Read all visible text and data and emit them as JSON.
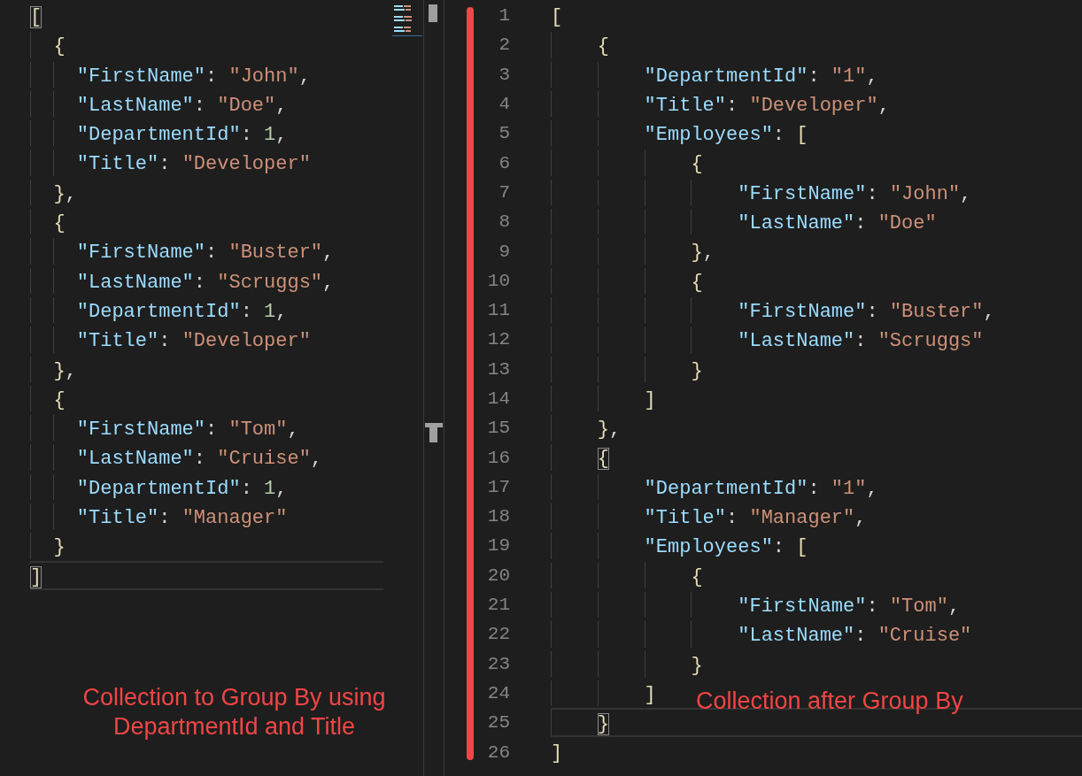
{
  "left_editor": {
    "lines": [
      {
        "current": false,
        "bracket_match": true,
        "tokens": [
          {
            "kind": "bracket",
            "text": "["
          }
        ],
        "children": [
          {
            "current": false,
            "bracket_match": false,
            "tokens": [
              {
                "kind": "bracket",
                "text": "{"
              }
            ],
            "children": [
              {
                "current": false,
                "bracket_match": false,
                "tokens": [
                  {
                    "kind": "key",
                    "text": "\"FirstName\""
                  },
                  {
                    "kind": "punct",
                    "text": ": "
                  },
                  {
                    "kind": "string",
                    "text": "\"John\""
                  },
                  {
                    "kind": "punct",
                    "text": ","
                  }
                ]
              },
              {
                "current": false,
                "bracket_match": false,
                "tokens": [
                  {
                    "kind": "key",
                    "text": "\"LastName\""
                  },
                  {
                    "kind": "punct",
                    "text": ": "
                  },
                  {
                    "kind": "string",
                    "text": "\"Doe\""
                  },
                  {
                    "kind": "punct",
                    "text": ","
                  }
                ]
              },
              {
                "current": false,
                "bracket_match": false,
                "tokens": [
                  {
                    "kind": "key",
                    "text": "\"DepartmentId\""
                  },
                  {
                    "kind": "punct",
                    "text": ": "
                  },
                  {
                    "kind": "number",
                    "text": "1"
                  },
                  {
                    "kind": "punct",
                    "text": ","
                  }
                ]
              },
              {
                "current": false,
                "bracket_match": false,
                "tokens": [
                  {
                    "kind": "key",
                    "text": "\"Title\""
                  },
                  {
                    "kind": "punct",
                    "text": ": "
                  },
                  {
                    "kind": "string",
                    "text": "\"Developer\""
                  }
                ]
              }
            ]
          },
          {
            "current": false,
            "bracket_match": false,
            "tokens": [
              {
                "kind": "bracket",
                "text": "}"
              },
              {
                "kind": "punct",
                "text": ","
              }
            ]
          },
          {
            "current": false,
            "bracket_match": false,
            "tokens": [
              {
                "kind": "bracket",
                "text": "{"
              }
            ],
            "children": [
              {
                "current": false,
                "bracket_match": false,
                "tokens": [
                  {
                    "kind": "key",
                    "text": "\"FirstName\""
                  },
                  {
                    "kind": "punct",
                    "text": ": "
                  },
                  {
                    "kind": "string",
                    "text": "\"Buster\""
                  },
                  {
                    "kind": "punct",
                    "text": ","
                  }
                ]
              },
              {
                "current": false,
                "bracket_match": false,
                "tokens": [
                  {
                    "kind": "key",
                    "text": "\"LastName\""
                  },
                  {
                    "kind": "punct",
                    "text": ": "
                  },
                  {
                    "kind": "string",
                    "text": "\"Scruggs\""
                  },
                  {
                    "kind": "punct",
                    "text": ","
                  }
                ]
              },
              {
                "current": false,
                "bracket_match": false,
                "tokens": [
                  {
                    "kind": "key",
                    "text": "\"DepartmentId\""
                  },
                  {
                    "kind": "punct",
                    "text": ": "
                  },
                  {
                    "kind": "number",
                    "text": "1"
                  },
                  {
                    "kind": "punct",
                    "text": ","
                  }
                ]
              },
              {
                "current": false,
                "bracket_match": false,
                "tokens": [
                  {
                    "kind": "key",
                    "text": "\"Title\""
                  },
                  {
                    "kind": "punct",
                    "text": ": "
                  },
                  {
                    "kind": "string",
                    "text": "\"Developer\""
                  }
                ]
              }
            ]
          },
          {
            "current": false,
            "bracket_match": false,
            "tokens": [
              {
                "kind": "bracket",
                "text": "}"
              },
              {
                "kind": "punct",
                "text": ","
              }
            ]
          },
          {
            "current": false,
            "bracket_match": false,
            "tokens": [
              {
                "kind": "bracket",
                "text": "{"
              }
            ],
            "children": [
              {
                "current": false,
                "bracket_match": false,
                "tokens": [
                  {
                    "kind": "key",
                    "text": "\"FirstName\""
                  },
                  {
                    "kind": "punct",
                    "text": ": "
                  },
                  {
                    "kind": "string",
                    "text": "\"Tom\""
                  },
                  {
                    "kind": "punct",
                    "text": ","
                  }
                ]
              },
              {
                "current": false,
                "bracket_match": false,
                "tokens": [
                  {
                    "kind": "key",
                    "text": "\"LastName\""
                  },
                  {
                    "kind": "punct",
                    "text": ": "
                  },
                  {
                    "kind": "string",
                    "text": "\"Cruise\""
                  },
                  {
                    "kind": "punct",
                    "text": ","
                  }
                ]
              },
              {
                "current": false,
                "bracket_match": false,
                "tokens": [
                  {
                    "kind": "key",
                    "text": "\"DepartmentId\""
                  },
                  {
                    "kind": "punct",
                    "text": ": "
                  },
                  {
                    "kind": "number",
                    "text": "1"
                  },
                  {
                    "kind": "punct",
                    "text": ","
                  }
                ]
              },
              {
                "current": false,
                "bracket_match": false,
                "tokens": [
                  {
                    "kind": "key",
                    "text": "\"Title\""
                  },
                  {
                    "kind": "punct",
                    "text": ": "
                  },
                  {
                    "kind": "string",
                    "text": "\"Manager\""
                  }
                ]
              }
            ]
          },
          {
            "current": false,
            "bracket_match": false,
            "tokens": [
              {
                "kind": "bracket",
                "text": "}"
              }
            ]
          }
        ]
      },
      {
        "current": true,
        "bracket_match": true,
        "tokens": [
          {
            "kind": "bracket",
            "text": "]"
          }
        ]
      }
    ],
    "caption": "Collection to Group By using DepartmentId and Title"
  },
  "right_editor": {
    "lines": [
      {
        "number": "1",
        "current": false,
        "bracket_match": false,
        "tokens": [
          {
            "kind": "bracket",
            "text": "["
          }
        ],
        "children": [
          {
            "number": "2",
            "current": false,
            "bracket_match": false,
            "tokens": [
              {
                "kind": "bracket",
                "text": "{"
              }
            ],
            "children": [
              {
                "number": "3",
                "current": false,
                "bracket_match": false,
                "tokens": [
                  {
                    "kind": "key",
                    "text": "\"DepartmentId\""
                  },
                  {
                    "kind": "punct",
                    "text": ": "
                  },
                  {
                    "kind": "string",
                    "text": "\"1\""
                  },
                  {
                    "kind": "punct",
                    "text": ","
                  }
                ]
              },
              {
                "number": "4",
                "current": false,
                "bracket_match": false,
                "tokens": [
                  {
                    "kind": "key",
                    "text": "\"Title\""
                  },
                  {
                    "kind": "punct",
                    "text": ": "
                  },
                  {
                    "kind": "string",
                    "text": "\"Developer\""
                  },
                  {
                    "kind": "punct",
                    "text": ","
                  }
                ]
              },
              {
                "number": "5",
                "current": false,
                "bracket_match": false,
                "tokens": [
                  {
                    "kind": "key",
                    "text": "\"Employees\""
                  },
                  {
                    "kind": "punct",
                    "text": ": "
                  },
                  {
                    "kind": "bracket",
                    "text": "["
                  }
                ],
                "children": [
                  {
                    "number": "6",
                    "current": false,
                    "bracket_match": false,
                    "tokens": [
                      {
                        "kind": "bracket",
                        "text": "{"
                      }
                    ],
                    "children": [
                      {
                        "number": "7",
                        "current": false,
                        "bracket_match": false,
                        "tokens": [
                          {
                            "kind": "key",
                            "text": "\"FirstName\""
                          },
                          {
                            "kind": "punct",
                            "text": ": "
                          },
                          {
                            "kind": "string",
                            "text": "\"John\""
                          },
                          {
                            "kind": "punct",
                            "text": ","
                          }
                        ]
                      },
                      {
                        "number": "8",
                        "current": false,
                        "bracket_match": false,
                        "tokens": [
                          {
                            "kind": "key",
                            "text": "\"LastName\""
                          },
                          {
                            "kind": "punct",
                            "text": ": "
                          },
                          {
                            "kind": "string",
                            "text": "\"Doe\""
                          }
                        ]
                      }
                    ]
                  },
                  {
                    "number": "9",
                    "current": false,
                    "bracket_match": false,
                    "tokens": [
                      {
                        "kind": "bracket",
                        "text": "}"
                      },
                      {
                        "kind": "punct",
                        "text": ","
                      }
                    ]
                  },
                  {
                    "number": "10",
                    "current": false,
                    "bracket_match": false,
                    "tokens": [
                      {
                        "kind": "bracket",
                        "text": "{"
                      }
                    ],
                    "children": [
                      {
                        "number": "11",
                        "current": false,
                        "bracket_match": false,
                        "tokens": [
                          {
                            "kind": "key",
                            "text": "\"FirstName\""
                          },
                          {
                            "kind": "punct",
                            "text": ": "
                          },
                          {
                            "kind": "string",
                            "text": "\"Buster\""
                          },
                          {
                            "kind": "punct",
                            "text": ","
                          }
                        ]
                      },
                      {
                        "number": "12",
                        "current": false,
                        "bracket_match": false,
                        "tokens": [
                          {
                            "kind": "key",
                            "text": "\"LastName\""
                          },
                          {
                            "kind": "punct",
                            "text": ": "
                          },
                          {
                            "kind": "string",
                            "text": "\"Scruggs\""
                          }
                        ]
                      }
                    ]
                  },
                  {
                    "number": "13",
                    "current": false,
                    "bracket_match": false,
                    "tokens": [
                      {
                        "kind": "bracket",
                        "text": "}"
                      }
                    ]
                  }
                ]
              },
              {
                "number": "14",
                "current": false,
                "bracket_match": false,
                "tokens": [
                  {
                    "kind": "bracket",
                    "text": "]"
                  }
                ]
              }
            ]
          },
          {
            "number": "15",
            "current": false,
            "bracket_match": false,
            "tokens": [
              {
                "kind": "bracket",
                "text": "}"
              },
              {
                "kind": "punct",
                "text": ","
              }
            ]
          },
          {
            "number": "16",
            "current": false,
            "bracket_match": true,
            "tokens": [
              {
                "kind": "bracket",
                "text": "{"
              }
            ],
            "children": [
              {
                "number": "17",
                "current": false,
                "bracket_match": false,
                "tokens": [
                  {
                    "kind": "key",
                    "text": "\"DepartmentId\""
                  },
                  {
                    "kind": "punct",
                    "text": ": "
                  },
                  {
                    "kind": "string",
                    "text": "\"1\""
                  },
                  {
                    "kind": "punct",
                    "text": ","
                  }
                ]
              },
              {
                "number": "18",
                "current": false,
                "bracket_match": false,
                "tokens": [
                  {
                    "kind": "key",
                    "text": "\"Title\""
                  },
                  {
                    "kind": "punct",
                    "text": ": "
                  },
                  {
                    "kind": "string",
                    "text": "\"Manager\""
                  },
                  {
                    "kind": "punct",
                    "text": ","
                  }
                ]
              },
              {
                "number": "19",
                "current": false,
                "bracket_match": false,
                "tokens": [
                  {
                    "kind": "key",
                    "text": "\"Employees\""
                  },
                  {
                    "kind": "punct",
                    "text": ": "
                  },
                  {
                    "kind": "bracket",
                    "text": "["
                  }
                ],
                "children": [
                  {
                    "number": "20",
                    "current": false,
                    "bracket_match": false,
                    "tokens": [
                      {
                        "kind": "bracket",
                        "text": "{"
                      }
                    ],
                    "children": [
                      {
                        "number": "21",
                        "current": false,
                        "bracket_match": false,
                        "tokens": [
                          {
                            "kind": "key",
                            "text": "\"FirstName\""
                          },
                          {
                            "kind": "punct",
                            "text": ": "
                          },
                          {
                            "kind": "string",
                            "text": "\"Tom\""
                          },
                          {
                            "kind": "punct",
                            "text": ","
                          }
                        ]
                      },
                      {
                        "number": "22",
                        "current": false,
                        "bracket_match": false,
                        "tokens": [
                          {
                            "kind": "key",
                            "text": "\"LastName\""
                          },
                          {
                            "kind": "punct",
                            "text": ": "
                          },
                          {
                            "kind": "string",
                            "text": "\"Cruise\""
                          }
                        ]
                      }
                    ]
                  },
                  {
                    "number": "23",
                    "current": false,
                    "bracket_match": false,
                    "tokens": [
                      {
                        "kind": "bracket",
                        "text": "}"
                      }
                    ]
                  }
                ]
              },
              {
                "number": "24",
                "current": false,
                "bracket_match": false,
                "tokens": [
                  {
                    "kind": "bracket",
                    "text": "]"
                  }
                ]
              }
            ]
          },
          {
            "number": "25",
            "current": true,
            "bracket_match": true,
            "tokens": [
              {
                "kind": "bracket",
                "text": "}"
              }
            ]
          }
        ]
      },
      {
        "number": "26",
        "current": false,
        "bracket_match": false,
        "tokens": [
          {
            "kind": "bracket",
            "text": "]"
          }
        ]
      }
    ],
    "caption": "Collection after Group By"
  }
}
